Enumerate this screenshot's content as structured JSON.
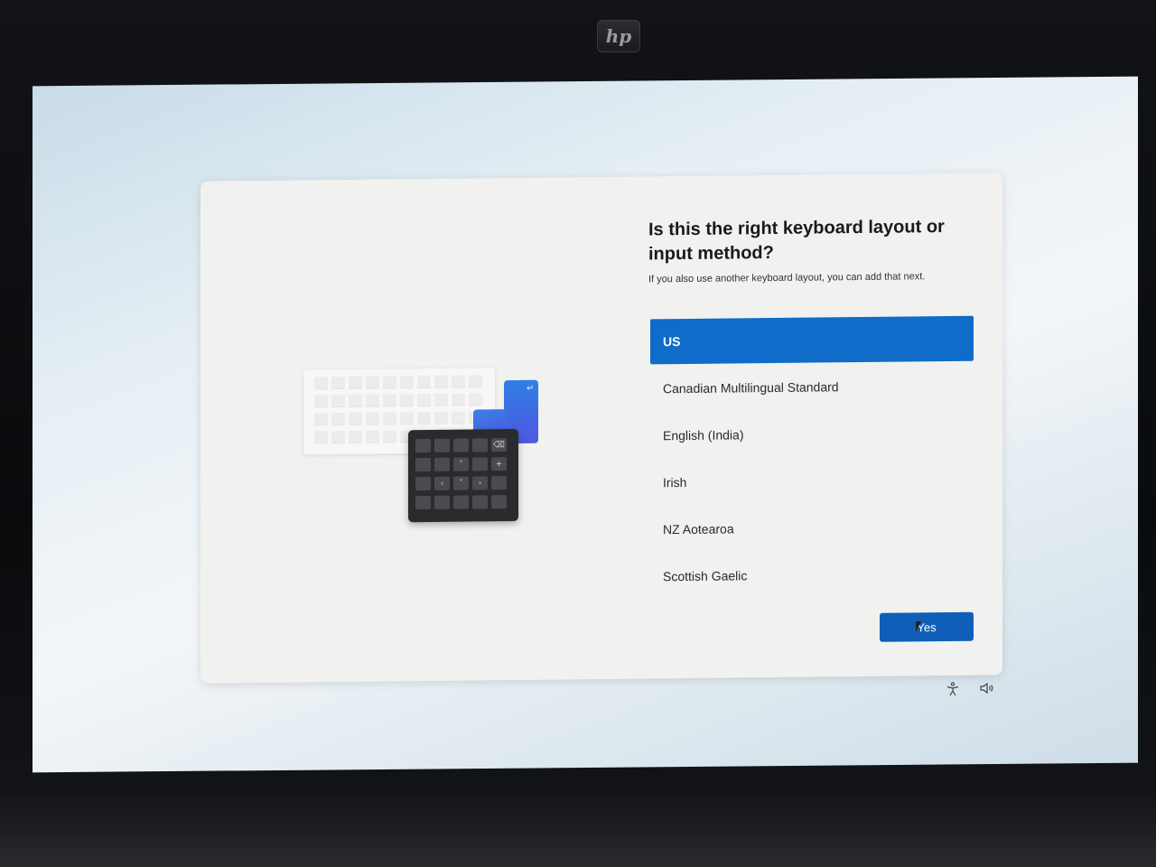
{
  "monitor": {
    "brand_logo": "hp"
  },
  "dialog": {
    "title": "Is this the right keyboard layout or input method?",
    "subtitle": "If you also use another keyboard layout, you can add that next.",
    "layouts": [
      {
        "label": "US",
        "selected": true
      },
      {
        "label": "Canadian Multilingual Standard",
        "selected": false
      },
      {
        "label": "English (India)",
        "selected": false
      },
      {
        "label": "Irish",
        "selected": false
      },
      {
        "label": "NZ Aotearoa",
        "selected": false
      },
      {
        "label": "Scottish Gaelic",
        "selected": false
      }
    ],
    "yes_label": "Yes"
  },
  "system_tray": {
    "icons": [
      "accessibility-icon",
      "volume-icon"
    ]
  },
  "colors": {
    "accent": "#0f6cc8",
    "button": "#0f5fb8",
    "dialog_bg": "#f1f1f0"
  }
}
